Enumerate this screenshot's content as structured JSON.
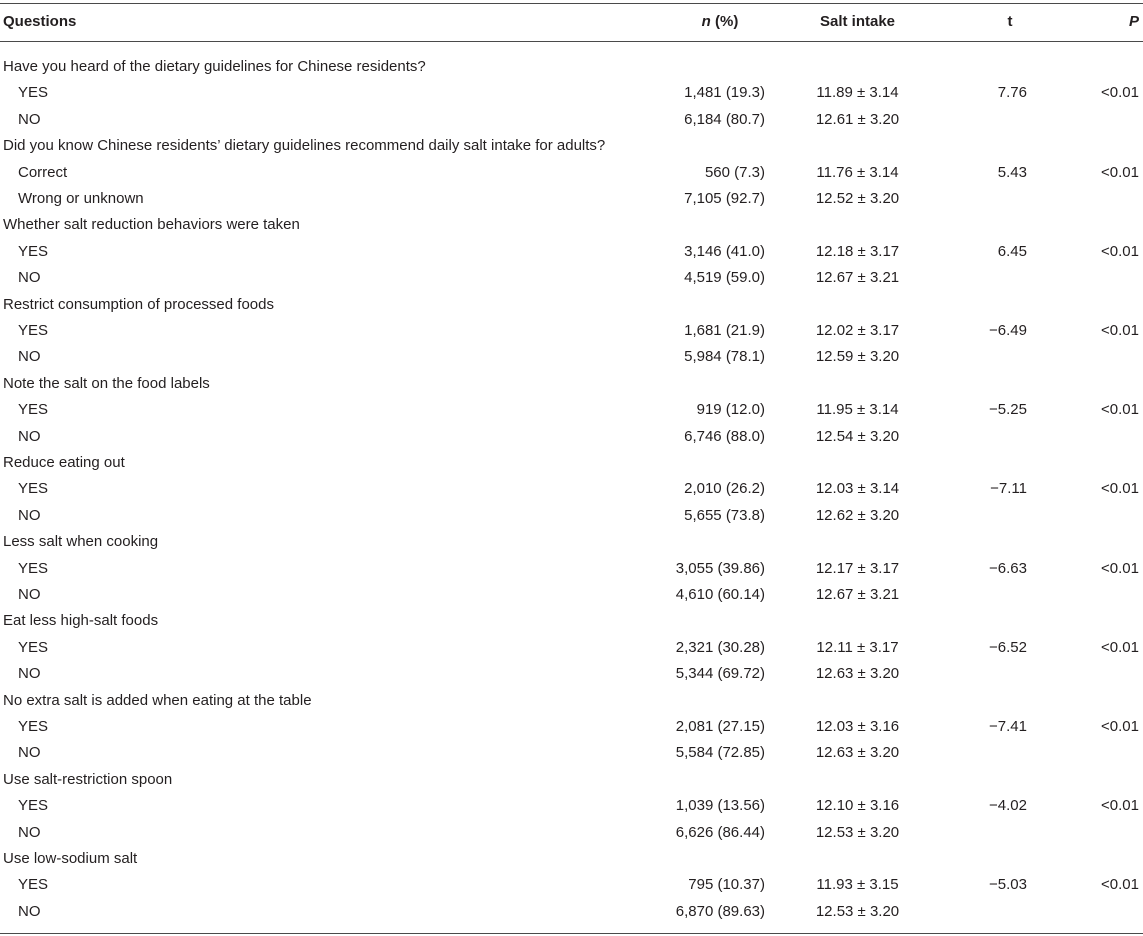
{
  "header": {
    "questions": "Questions",
    "n_label": "n",
    "n_suffix": " (%)",
    "salt_intake": "Salt intake",
    "t": "t",
    "p": "P"
  },
  "groups": [
    {
      "question": "Have you heard of the dietary guidelines for Chinese residents?",
      "rows": [
        {
          "label": "YES",
          "n": "1,481 (19.3)",
          "salt": "11.89 ± 3.14",
          "t": "7.76",
          "p": "<0.01"
        },
        {
          "label": "NO",
          "n": "6,184 (80.7)",
          "salt": "12.61 ± 3.20",
          "t": "",
          "p": ""
        }
      ]
    },
    {
      "question": "Did you know Chinese residents’ dietary guidelines recommend daily salt intake for adults?",
      "rows": [
        {
          "label": "Correct",
          "n": "560 (7.3)",
          "salt": "11.76 ± 3.14",
          "t": "5.43",
          "p": "<0.01"
        },
        {
          "label": "Wrong or unknown",
          "n": "7,105 (92.7)",
          "salt": "12.52 ± 3.20",
          "t": "",
          "p": ""
        }
      ]
    },
    {
      "question": "Whether salt reduction behaviors were taken",
      "rows": [
        {
          "label": "YES",
          "n": "3,146 (41.0)",
          "salt": "12.18 ± 3.17",
          "t": "6.45",
          "p": "<0.01"
        },
        {
          "label": "NO",
          "n": "4,519 (59.0)",
          "salt": "12.67 ± 3.21",
          "t": "",
          "p": ""
        }
      ]
    },
    {
      "question": "Restrict consumption of processed foods",
      "rows": [
        {
          "label": "YES",
          "n": "1,681 (21.9)",
          "salt": "12.02 ± 3.17",
          "t": "−6.49",
          "p": "<0.01"
        },
        {
          "label": "NO",
          "n": "5,984 (78.1)",
          "salt": "12.59 ± 3.20",
          "t": "",
          "p": ""
        }
      ]
    },
    {
      "question": "Note the salt on the food labels",
      "rows": [
        {
          "label": "YES",
          "n": "919 (12.0)",
          "salt": "11.95 ± 3.14",
          "t": "−5.25",
          "p": "<0.01"
        },
        {
          "label": "NO",
          "n": "6,746 (88.0)",
          "salt": "12.54 ± 3.20",
          "t": "",
          "p": ""
        }
      ]
    },
    {
      "question": "Reduce eating out",
      "rows": [
        {
          "label": "YES",
          "n": "2,010 (26.2)",
          "salt": "12.03 ± 3.14",
          "t": "−7.11",
          "p": "<0.01"
        },
        {
          "label": "NO",
          "n": "5,655 (73.8)",
          "salt": "12.62 ± 3.20",
          "t": "",
          "p": ""
        }
      ]
    },
    {
      "question": "Less salt when cooking",
      "rows": [
        {
          "label": "YES",
          "n": "3,055 (39.86)",
          "salt": "12.17 ± 3.17",
          "t": "−6.63",
          "p": "<0.01"
        },
        {
          "label": "NO",
          "n": "4,610 (60.14)",
          "salt": "12.67 ± 3.21",
          "t": "",
          "p": ""
        }
      ]
    },
    {
      "question": "Eat less high-salt foods",
      "rows": [
        {
          "label": "YES",
          "n": "2,321 (30.28)",
          "salt": "12.11 ± 3.17",
          "t": "−6.52",
          "p": "<0.01"
        },
        {
          "label": "NO",
          "n": "5,344 (69.72)",
          "salt": "12.63 ± 3.20",
          "t": "",
          "p": ""
        }
      ]
    },
    {
      "question": "No extra salt is added when eating at the table",
      "rows": [
        {
          "label": "YES",
          "n": "2,081 (27.15)",
          "salt": "12.03 ± 3.16",
          "t": "−7.41",
          "p": "<0.01"
        },
        {
          "label": "NO",
          "n": "5,584 (72.85)",
          "salt": "12.63 ± 3.20",
          "t": "",
          "p": ""
        }
      ]
    },
    {
      "question": "Use salt-restriction spoon",
      "rows": [
        {
          "label": "YES",
          "n": "1,039 (13.56)",
          "salt": "12.10 ± 3.16",
          "t": "−4.02",
          "p": "<0.01"
        },
        {
          "label": "NO",
          "n": "6,626 (86.44)",
          "salt": "12.53 ± 3.20",
          "t": "",
          "p": ""
        }
      ]
    },
    {
      "question": "Use low-sodium salt",
      "rows": [
        {
          "label": "YES",
          "n": "795 (10.37)",
          "salt": "11.93 ± 3.15",
          "t": "−5.03",
          "p": "<0.01"
        },
        {
          "label": "NO",
          "n": "6,870 (89.63)",
          "salt": "12.53 ± 3.20",
          "t": "",
          "p": ""
        }
      ]
    }
  ]
}
